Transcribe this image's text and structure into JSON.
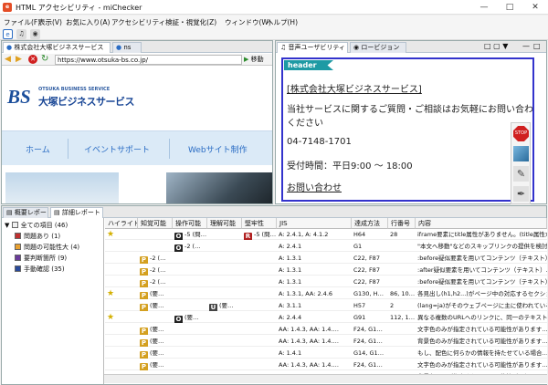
{
  "window": {
    "title": "HTML アクセシビリティ - miChecker"
  },
  "menu": [
    "ファイル(F)",
    "表示(V)",
    "お気に入り(A)",
    "アクセシビリティ検証・視覚化(Z)",
    "ウィンドウ(W)",
    "ヘルプ(H)"
  ],
  "left_tabs": [
    {
      "label": "株式会社大塚ビジネスサービス"
    },
    {
      "label": "ns"
    }
  ],
  "address": {
    "url": "https://www.otsuka-bs.co.jp/",
    "go": "移動"
  },
  "site": {
    "logo_mark": "BS",
    "logo_sub": "OTSUKA BUSINESS SERVICE",
    "logo_name": "大塚ビジネスサービス",
    "nav": [
      "ホーム",
      "イベントサポート",
      "Webサイト制作"
    ]
  },
  "right_tabs": [
    {
      "label": "音声ユーザビリティ"
    },
    {
      "label": "ロービジョン"
    }
  ],
  "voice": {
    "badge": "header",
    "lines": [
      "[株式会社大塚ビジネスサービス]",
      "当社サービスに関するご質問・ご相談はお気軽にお問い合わせ",
      "ください",
      "04-7148-1701",
      "受付時間：平日9:00 〜 18:00",
      "お問い合わせ"
    ]
  },
  "bottom_tabs": [
    {
      "label": "概要レポート"
    },
    {
      "label": "詳細レポート"
    }
  ],
  "tree": [
    {
      "label": "全ての項目 (46)",
      "color": "#f0f0f0"
    },
    {
      "label": "問題あり (1)",
      "color": "#c03030"
    },
    {
      "label": "問題の可能性大 (4)",
      "color": "#e8a030"
    },
    {
      "label": "要判断箇所 (9)",
      "color": "#6a3a9a"
    },
    {
      "label": "手動確認 (35)",
      "color": "#2a4a9a"
    }
  ],
  "columns": [
    "ハイライト",
    "知覚可能",
    "操作可能",
    "理解可能",
    "堅牢性",
    "JIS",
    "達成方法",
    "行番号",
    "内容"
  ],
  "rows": [
    {
      "star": true,
      "p": "",
      "o": "O -5 (問…",
      "u": "",
      "r": "R -5 (問…",
      "jis": "A: 2.4.1, A: 4.1.2",
      "tech": "H64",
      "line": "28",
      "content": "iframe要素にtitle属性がありません。(title属性が…"
    },
    {
      "star": false,
      "p": "",
      "o": "O -2 (…",
      "u": "",
      "r": "",
      "jis": "A: 2.4.1",
      "tech": "G1",
      "line": "",
      "content": "\"本文へ移動\"などのスキップリンクの提供を検討…"
    },
    {
      "star": false,
      "p": "P -2 (…",
      "o": "",
      "u": "",
      "r": "",
      "jis": "A: 1.3.1",
      "tech": "C22, F87",
      "line": "",
      "content": ":before疑似要素を用いてコンテンツ（テキスト）…"
    },
    {
      "star": false,
      "p": "P -2 (…",
      "o": "",
      "u": "",
      "r": "",
      "jis": "A: 1.3.1",
      "tech": "C22, F87",
      "line": "",
      "content": ":after疑似要素を用いてコンテンツ（テキスト）…"
    },
    {
      "star": false,
      "p": "P -2 (…",
      "o": "",
      "u": "",
      "r": "",
      "jis": "A: 1.3.1",
      "tech": "C22, F87",
      "line": "",
      "content": ":before疑似要素を用いてコンテンツ（テキスト）…"
    },
    {
      "star": true,
      "p": "P (要…",
      "o": "",
      "u": "",
      "r": "",
      "jis": "A: 1.3.1, AA: 2.4.6",
      "tech": "G130, H…",
      "line": "86, 10…",
      "content": "各見出し(h1,h2...)がページ中の対応するセクション…"
    },
    {
      "star": false,
      "p": "P (要…",
      "o": "",
      "u": "U (要…",
      "r": "",
      "jis": "A: 3.1.1",
      "tech": "H57",
      "line": "2",
      "content": "(lang=ja)がそのウェブページに主に使われている…"
    },
    {
      "star": true,
      "p": "",
      "o": "O (要…",
      "u": "",
      "r": "",
      "jis": "A: 2.4.4",
      "tech": "G91",
      "line": "112, 1…",
      "content": "異なる複数のURLへのリンクに、同一のテキスト…"
    },
    {
      "star": false,
      "p": "P (要…",
      "o": "",
      "u": "",
      "r": "",
      "jis": "AA: 1.4.3, AA: 1.4.…",
      "tech": "F24, G1…",
      "line": "",
      "content": "文字色のみが指定されている可能性があります…"
    },
    {
      "star": false,
      "p": "P (要…",
      "o": "",
      "u": "",
      "r": "",
      "jis": "AA: 1.4.3, AA: 1.4.…",
      "tech": "F24, G1…",
      "line": "",
      "content": "背景色のみが指定されている可能性があります…"
    },
    {
      "star": false,
      "p": "P (要…",
      "o": "",
      "u": "",
      "r": "",
      "jis": "A: 1.4.1",
      "tech": "G14, G1…",
      "line": "",
      "content": "もし、配色に何らかの情報を持たせている場合…"
    },
    {
      "star": false,
      "p": "P (要…",
      "o": "",
      "u": "",
      "r": "",
      "jis": "AA: 1.4.3, AA: 1.4.…",
      "tech": "F24, G1…",
      "line": "",
      "content": "文字色のみが指定されている可能性があります…"
    },
    {
      "star": false,
      "p": "P (要…",
      "o": "",
      "u": "",
      "r": "",
      "jis": "AA: 1.4.3, AA: 1.4.…",
      "tech": "F24, G1…",
      "line": "",
      "content": "背景色のみが指定されている可能性があります…"
    }
  ]
}
